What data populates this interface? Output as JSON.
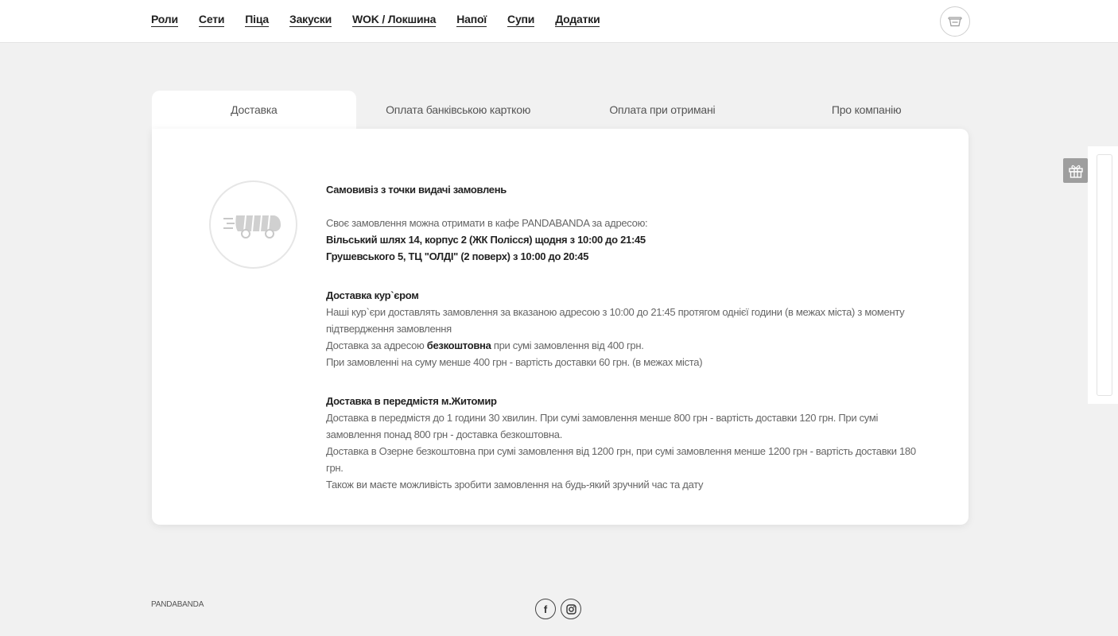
{
  "nav": {
    "items": [
      {
        "label": "Роли"
      },
      {
        "label": "Сети"
      },
      {
        "label": "Піца"
      },
      {
        "label": "Закуски"
      },
      {
        "label": "WOK / Локшина"
      },
      {
        "label": "Напої"
      },
      {
        "label": "Супи"
      },
      {
        "label": "Додатки"
      }
    ],
    "cart_icon": "cart-icon"
  },
  "tabs": [
    {
      "label": "Доставка",
      "active": true
    },
    {
      "label": "Оплата банківською карткою",
      "active": false
    },
    {
      "label": "Оплата при отримані",
      "active": false
    },
    {
      "label": "Про компанію",
      "active": false
    }
  ],
  "delivery": {
    "icon": "delivery-scooter-icon",
    "pickup": {
      "title": "Самовивіз з точки видачі замовлень",
      "intro": "Своє замовлення можна отримати в кафе PANDABANDA за адресою:",
      "address1": "Вільський шлях 14, корпус 2 (ЖК Полісся) щодня з 10:00 до 21:45",
      "address2": "Грушевського 5, ТЦ \"ОЛДІ\" (2 поверх) з 10:00 до 20:45"
    },
    "courier": {
      "title": "Доставка кур`єром",
      "line1": "Наші кур`єри доставлять замовлення за вказаною адресою з 10:00 до 21:45 протягом однієї години (в межах міста) з моменту підтвердження замовлення",
      "line2_pre": "Доставка за адресою ",
      "line2_bold": "безкоштовна",
      "line2_post": " при сумі замовлення від 400 грн.",
      "line3": "При замовленні на суму менше 400 грн - вартість доставки 60 грн. (в межах міста)"
    },
    "suburb": {
      "title": "Доставка в передмістя м.Житомир",
      "line1": "Доставка в передмістя до 1 години 30 хвилин. При сумі замовлення менше 800 грн - вартість доставки 120 грн. При сумі замовлення понад 800 грн - доставка безкоштовна.",
      "line2": "Доставка в Озерне безкоштовна при сумі замовлення від 1200 грн, при сумі замовлення менше 1200 грн - вартість доставки 180 грн.",
      "line3": "Також ви маєте можливість зробити замовлення на будь-який зручний час та дату"
    }
  },
  "side": {
    "gift_icon": "gift-icon"
  },
  "footer": {
    "brand": "PANDABANDA",
    "facebook_label": "f",
    "instagram_icon": "instagram-icon"
  }
}
